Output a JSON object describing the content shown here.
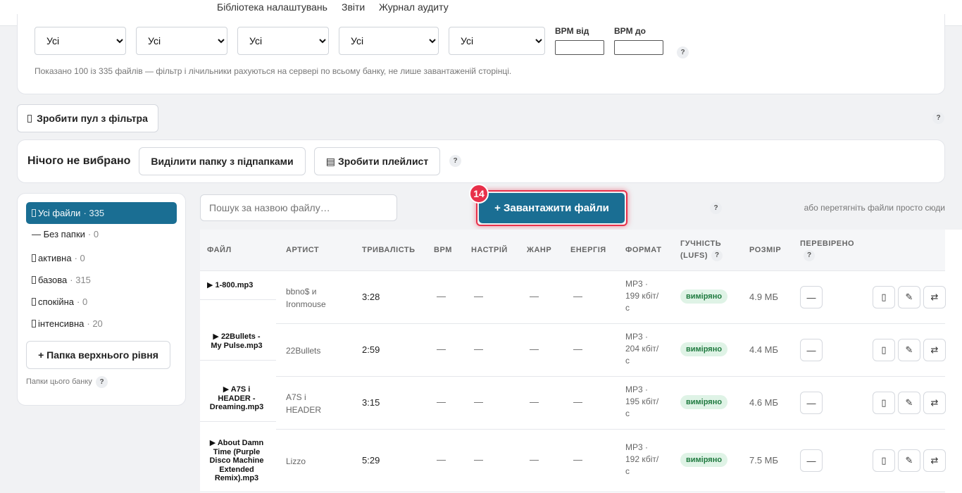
{
  "topnav": [
    "Бібліотека налаштувань",
    "Звіти",
    "Журнал аудиту"
  ],
  "filters": {
    "selects": [
      "Усі",
      "Усі",
      "Усі",
      "Усі",
      "Усі"
    ],
    "bpm_from_label": "BPM від",
    "bpm_to_label": "BPM до",
    "help": "?",
    "info": "Показано 100 із 335 файлів — фільтр і лічильники рахуються на сервері по всьому банку, не лише завантаженій сторінці."
  },
  "pool": {
    "button": "Зробити пул з фільтра",
    "help": "?"
  },
  "selection": {
    "status": "Нічого не вибрано",
    "select_folder": "Виділити папку з підпапками",
    "playlist_icon": "▤",
    "playlist": "Зробити плейлист",
    "help": "?"
  },
  "sidebar": {
    "items": [
      {
        "label": "Усі файли",
        "count": "· 335",
        "icon": "folder-icon"
      },
      {
        "label": "— Без папки",
        "count": "· 0",
        "icon": ""
      },
      {
        "label": "активна",
        "count": "· 0",
        "icon": "folder-icon"
      },
      {
        "label": "базова",
        "count": "· 315",
        "icon": "folder-icon"
      },
      {
        "label": "спокійна",
        "count": "· 0",
        "icon": "folder-icon"
      },
      {
        "label": "інтенсивна",
        "count": "· 20",
        "icon": "folder-icon"
      }
    ],
    "add_root": "+ Папка верхнього рівня",
    "footer": "Папки цього банку",
    "help": "?"
  },
  "toolbar": {
    "search_placeholder": "Пошук за назвою файлу…",
    "upload": "+ Завантажити файли",
    "step_badge": "14",
    "help": "?",
    "drop_hint": "або перетягніть файли просто сюди"
  },
  "table": {
    "headers": [
      "ФАЙЛ",
      "АРТИСТ",
      "ТРИВАЛІСТЬ",
      "BPM",
      "НАСТРІЙ",
      "ЖАНР",
      "ЕНЕРГІЯ",
      "ФОРМАТ",
      "ГУЧНІСТЬ",
      "(LUFS)",
      "РОЗМІР",
      "ПЕРЕВІРЕНО"
    ],
    "rows": [
      {
        "file": [
          "▶ 1-800.mp3"
        ],
        "artist": [
          "bbno$ и",
          "Ironmouse"
        ],
        "duration": "3:28",
        "bpm": "—",
        "mood": "—",
        "genre": "—",
        "energy": "—",
        "format": [
          "MP3 ·",
          "199 кбіт/",
          "с"
        ],
        "loudness": "виміряно",
        "size": "4.9 МБ",
        "verified": "—"
      },
      {
        "file": [
          "▶ 22Bullets -",
          "My Pulse.mp3"
        ],
        "artist": [
          "22Bullets"
        ],
        "duration": "2:59",
        "bpm": "—",
        "mood": "—",
        "genre": "—",
        "energy": "—",
        "format": [
          "MP3 ·",
          "204 кбіт/",
          "с"
        ],
        "loudness": "виміряно",
        "size": "4.4 МБ",
        "verified": "—"
      },
      {
        "file": [
          "▶ A7S i",
          "HEADER -",
          "Dreaming.mp3"
        ],
        "artist": [
          "A7S i",
          "HEADER"
        ],
        "duration": "3:15",
        "bpm": "—",
        "mood": "—",
        "genre": "—",
        "energy": "—",
        "format": [
          "MP3 ·",
          "195 кбіт/",
          "с"
        ],
        "loudness": "виміряно",
        "size": "4.6 МБ",
        "verified": "—"
      },
      {
        "file": [
          "▶ About Damn",
          "Time (Purple",
          "Disco Machine",
          "Extended",
          "Remix).mp3"
        ],
        "artist": [
          "Lizzo"
        ],
        "duration": "5:29",
        "bpm": "—",
        "mood": "—",
        "genre": "—",
        "energy": "—",
        "format": [
          "MP3 ·",
          "192 кбіт/",
          "с"
        ],
        "loudness": "виміряно",
        "size": "7.5 МБ",
        "verified": "—"
      }
    ],
    "actions": {
      "icon_a": "▯",
      "edit": "✎",
      "swap": "⇄"
    }
  },
  "colors": {
    "accent": "#1a6e93",
    "upload_ring": "#e8304a",
    "measured_bg": "#dff3e6",
    "measured_fg": "#1f7a3f"
  }
}
